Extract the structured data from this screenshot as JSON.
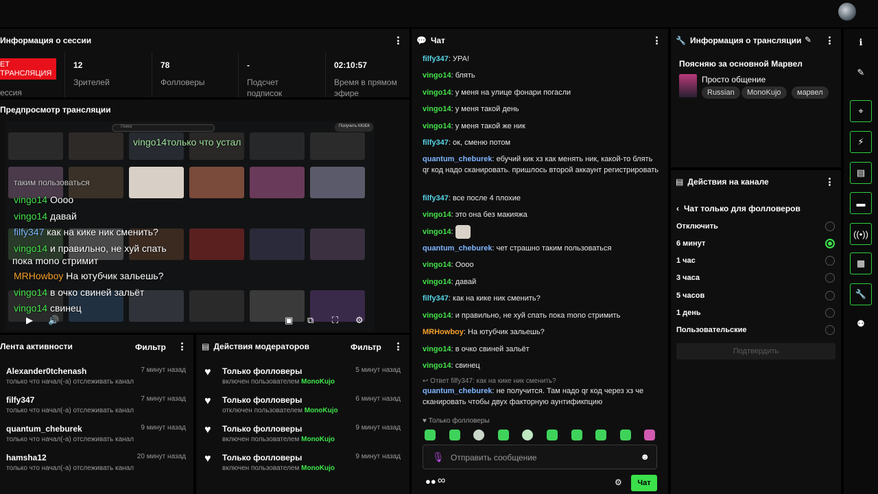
{
  "session": {
    "title": "Информация о сессии",
    "live_label": "ЕТ\nТРАНСЛЯЦИЯ",
    "session_label": "ессия",
    "stats": [
      {
        "value": "12",
        "label": "Зрителей"
      },
      {
        "value": "78",
        "label": "Фолловеры"
      },
      {
        "value": "-",
        "label": "Подсчет подписок"
      },
      {
        "value": "02:10:57",
        "label": "Время в прямом эфире"
      }
    ]
  },
  "preview": {
    "title": "Предпросмотр трансляции",
    "search_placeholder": "Поиск",
    "get_button": "Получить КЮБК",
    "top_overlay": "vingo14только что устал",
    "overlay_lines": [
      {
        "user": "",
        "text": "таким пользоваться"
      },
      {
        "user": "vingo14",
        "text": "Оооо"
      },
      {
        "user": "vingo14",
        "text": "давай"
      },
      {
        "user": "filfy347",
        "text": "как на кике ник сменить?"
      },
      {
        "user": "vingo14",
        "text": "и правильно, не хуй спать"
      },
      {
        "user": "",
        "text": "пока mono стримит"
      },
      {
        "user": "MRHowboy",
        "text": "На ютубчик зальешь?"
      },
      {
        "user": "vingo14",
        "text": "в очко свиней зальёт"
      },
      {
        "user": "vingo14",
        "text": "свинец"
      }
    ]
  },
  "activity": {
    "title": "Лента активности",
    "filter_label": "Фильтр",
    "items": [
      {
        "name": "Alexander0tchenash",
        "sub": "только что начал(-а) отслеживать канал",
        "time": "7 минут назад"
      },
      {
        "name": "filfy347",
        "sub": "только что начал(-а) отслеживать канал",
        "time": "7 минут назад"
      },
      {
        "name": "quantum_cheburek",
        "sub": "только что начал(-а) отслеживать канал",
        "time": "9 минут назад"
      },
      {
        "name": "hamsha12",
        "sub": "только что начал(-а) отслеживать канал",
        "time": "20 минут назад"
      }
    ]
  },
  "modactions": {
    "title": "Действия модераторов",
    "filter_label": "Фильтр",
    "items": [
      {
        "name": "Только фолловеры",
        "sub": "включен пользователем",
        "user": "MonoKujo",
        "time": "5 минут назад"
      },
      {
        "name": "Только фолловеры",
        "sub": "отключен пользователем",
        "user": "MonoKujo",
        "time": "6 минут назад"
      },
      {
        "name": "Только фолловеры",
        "sub": "включен пользователем",
        "user": "MonoKujo",
        "time": "9 минут назад"
      },
      {
        "name": "Только фолловеры",
        "sub": "включен пользователем",
        "user": "MonoKujo",
        "time": "9 минут назад"
      }
    ]
  },
  "chat": {
    "title": "Чат",
    "messages": [
      {
        "user": "filfy347",
        "text": "УРА!"
      },
      {
        "user": "vingo14",
        "text": "блять"
      },
      {
        "user": "vingo14",
        "text": "у меня на улице фонари погасли"
      },
      {
        "user": "vingo14",
        "text": "у меня такой день"
      },
      {
        "user": "vingo14",
        "text": "у меня такой же ник"
      },
      {
        "user": "filfy347",
        "text": "ок, сменю потом"
      },
      {
        "user": "quantum_cheburek",
        "text": "ебучий кик хз как менять ник, какой-то блять qr код надо сканировать. пришлось второй аккаунт регистрировать"
      },
      {
        "user": "filfy347",
        "text": "все после 4 плохие"
      },
      {
        "user": "vingo14",
        "text": "это она без макияжа"
      },
      {
        "user": "vingo14",
        "text": ""
      },
      {
        "user": "quantum_cheburek",
        "text": "чет страшно таким пользоваться"
      },
      {
        "user": "vingo14",
        "text": "Оооо"
      },
      {
        "user": "vingo14",
        "text": "давай"
      },
      {
        "user": "filfy347",
        "text": "как на кике ник сменить?"
      },
      {
        "user": "vingo14",
        "text": "и правильно, не хуй спать пока mono стримить"
      },
      {
        "user": "MRHowboy",
        "text": "На ютубчик зальешь?"
      },
      {
        "user": "vingo14",
        "text": "в очко свиней зальёт"
      },
      {
        "user": "vingo14",
        "text": "свинец"
      }
    ],
    "reply_label": "Ответ filfy347: как на кике ник сменить?",
    "reply_user": "quantum_cheburek",
    "reply_text": "не получится. Там надо qr код через хз че сканировать чтобы двух факторную аунтификпцию",
    "followers_only_label": "Только фолловеры",
    "input_placeholder": "Отправить сообщение",
    "send_label": "Чат",
    "infinity_label": "∞"
  },
  "stream_info": {
    "title": "Информация о трансляции",
    "stream_title": "Поясняю за основной Марвел",
    "category": "Просто общение",
    "tags": [
      "Russian",
      "MonoKujo",
      "марвел"
    ]
  },
  "channel_actions": {
    "title": "Действия на канале",
    "back_title": "Чат только для фолловеров",
    "options": [
      {
        "label": "Отключить",
        "selected": false
      },
      {
        "label": "6 минут",
        "selected": true
      },
      {
        "label": "1 час",
        "selected": false
      },
      {
        "label": "3 часа",
        "selected": false
      },
      {
        "label": "5 часов",
        "selected": false
      },
      {
        "label": "1 день",
        "selected": false
      },
      {
        "label": "Пользовательские",
        "selected": false
      }
    ],
    "confirm_label": "Подтвердить"
  },
  "sidebar": {
    "icons": [
      "info-icon",
      "pencil-icon",
      "focus-icon",
      "bolt-icon",
      "notes-icon",
      "chat-bubble-icon",
      "broadcast-icon",
      "video-clips-icon",
      "wrench-icon",
      "people-icon"
    ]
  },
  "colors": {
    "accent_green": "#3be04a",
    "live_red": "#e8101a"
  }
}
